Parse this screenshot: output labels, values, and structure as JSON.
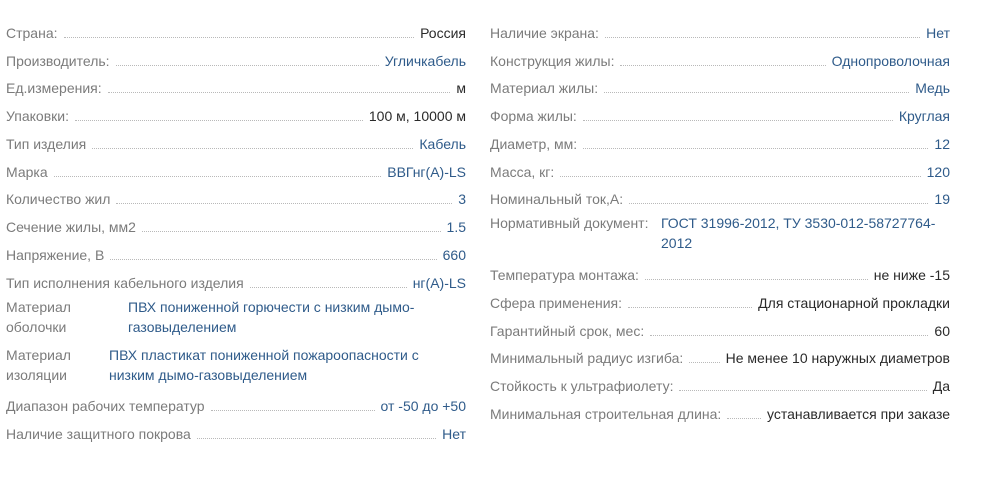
{
  "left": [
    {
      "label": "Страна:",
      "value": "Россия",
      "link": false
    },
    {
      "label": "Производитель:",
      "value": "Угличкабель",
      "link": true
    },
    {
      "label": "Ед.измерения:",
      "value": "м",
      "link": false
    },
    {
      "label": "Упаковки:",
      "value": "100 м, 10000 м",
      "link": false
    },
    {
      "label": "Тип изделия",
      "value": "Кабель",
      "link": true
    },
    {
      "label": "Марка",
      "value": "ВВГнг(А)-LS",
      "link": true
    },
    {
      "label": "Количество жил",
      "value": "3",
      "link": true
    },
    {
      "label": "Сечение жилы, мм2",
      "value": "1.5",
      "link": true
    },
    {
      "label": "Напряжение, В",
      "value": "660",
      "link": true
    },
    {
      "label": "Тип исполнения кабельного изделия",
      "value": "нг(A)-LS",
      "link": true
    },
    {
      "label": "Материал оболочки",
      "value": "ПВХ пониженной горючести с низким дымо-газовыделением",
      "link": true,
      "tall": true
    },
    {
      "label": "Материал изоляции",
      "value": "ПВХ пластикат пониженной пожароопасности с низким дымо-газовыделением",
      "link": true,
      "tall": true
    },
    {
      "label": "Диапазон рабочих температур",
      "value": "от -50 до +50",
      "link": true
    },
    {
      "label": "Наличие защитного покрова",
      "value": "Нет",
      "link": true
    }
  ],
  "right": [
    {
      "label": "Наличие экрана:",
      "value": "Нет",
      "link": true
    },
    {
      "label": "Конструкция жилы:",
      "value": "Однопроволочная",
      "link": true
    },
    {
      "label": "Материал жилы:",
      "value": "Медь",
      "link": true
    },
    {
      "label": "Форма жилы:",
      "value": "Круглая",
      "link": true
    },
    {
      "label": "Диаметр, мм:",
      "value": "12",
      "link": true
    },
    {
      "label": "Масса, кг:",
      "value": "120",
      "link": true
    },
    {
      "label": "Номинальный ток,А:",
      "value": "19",
      "link": true
    },
    {
      "label": "Нормативный документ:",
      "value": "ГОСТ 31996-2012, ТУ 3530-012-58727764-2012",
      "link": true,
      "tall": true
    },
    {
      "label": "Температура монтажа:",
      "value": "не ниже -15",
      "link": false
    },
    {
      "label": "Сфера применения:",
      "value": "Для стационарной прокладки",
      "link": false
    },
    {
      "label": "Гарантийный срок, мес:",
      "value": "60",
      "link": false
    },
    {
      "label": "Минимальный радиус изгиба:",
      "value": "Не менее 10 наружных диаметров",
      "link": false
    },
    {
      "label": "Стойкость к ультрафиолету:",
      "value": "Да",
      "link": false
    },
    {
      "label": "Минимальная строительная длина:",
      "value": "устанавливается при заказе",
      "link": false
    }
  ]
}
